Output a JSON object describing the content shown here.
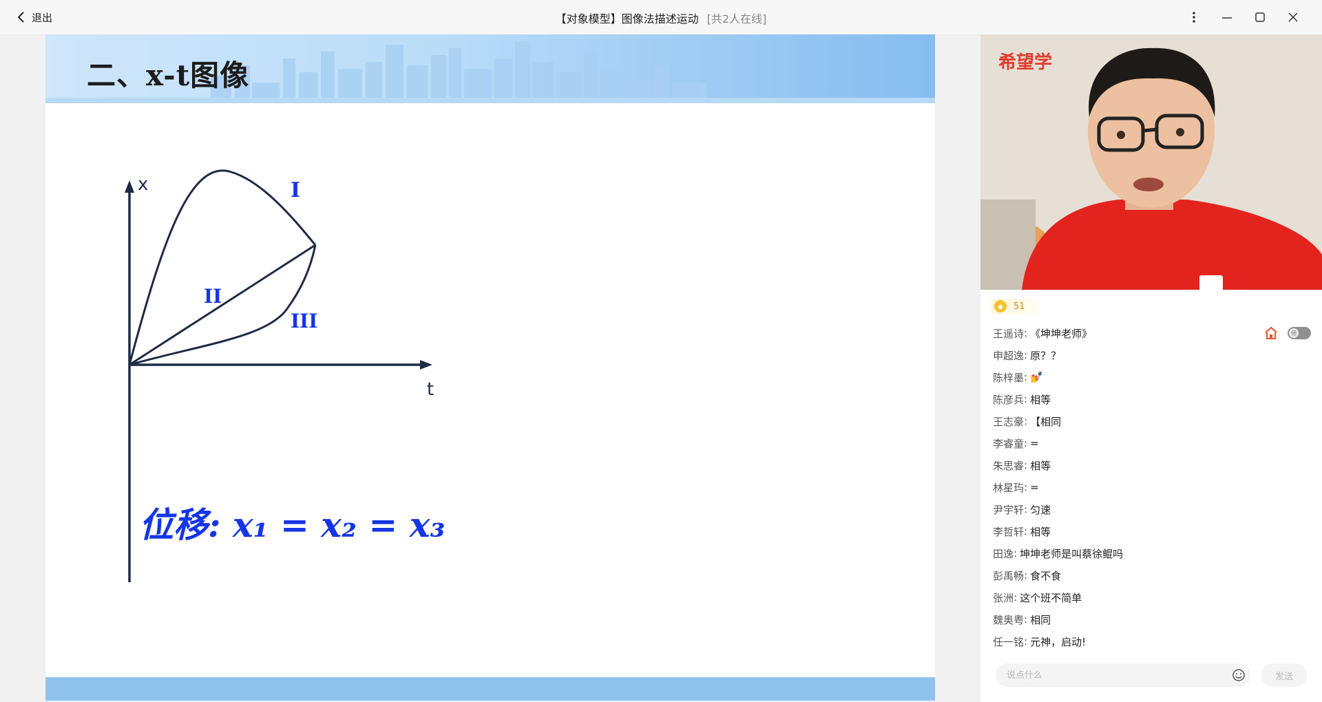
{
  "titlebar": {
    "back_label": "退出",
    "title": "【对象模型】图像法描述运动",
    "online": "[共2人在线]"
  },
  "slide": {
    "title": "二、x-t图像",
    "graph": {
      "x_axis_label": "t",
      "y_axis_label": "x",
      "curve_labels": [
        "I",
        "II",
        "III"
      ],
      "handwritten_note": "位移: x₁ = x₂ = x₃"
    }
  },
  "video": {
    "brand": "希望学"
  },
  "likes": {
    "count": "51"
  },
  "chat": {
    "messages": [
      {
        "name": "王遥诗",
        "text": "《坤坤老师》"
      },
      {
        "name": "申超逸",
        "text": "原？？"
      },
      {
        "name": "陈梓墨",
        "text": "💅"
      },
      {
        "name": "陈彦兵",
        "text": "相等"
      },
      {
        "name": "王志豪",
        "text": "【相同"
      },
      {
        "name": "李睿童",
        "text": "="
      },
      {
        "name": "朱思睿",
        "text": "相等"
      },
      {
        "name": "林星玙",
        "text": "="
      },
      {
        "name": "尹宇轩",
        "text": "匀速"
      },
      {
        "name": "李哲轩",
        "text": "相等"
      },
      {
        "name": "田逸",
        "text": "坤坤老师是叫蔡徐鲲吗"
      },
      {
        "name": "彭禹畅",
        "text": "食不食"
      },
      {
        "name": "张洲",
        "text": "这个班不简单"
      },
      {
        "name": "魏奥粤",
        "text": "相同"
      },
      {
        "name": "任一铭",
        "text": "元神，启动!"
      }
    ],
    "toggle_label": "师",
    "input_placeholder": "说点什么",
    "send_label": "发送"
  },
  "colors": {
    "ink_blue": "#1535e6",
    "axis": "#1f2a44",
    "brand_red": "#e03b2e",
    "header_blue": "#86bcef"
  }
}
